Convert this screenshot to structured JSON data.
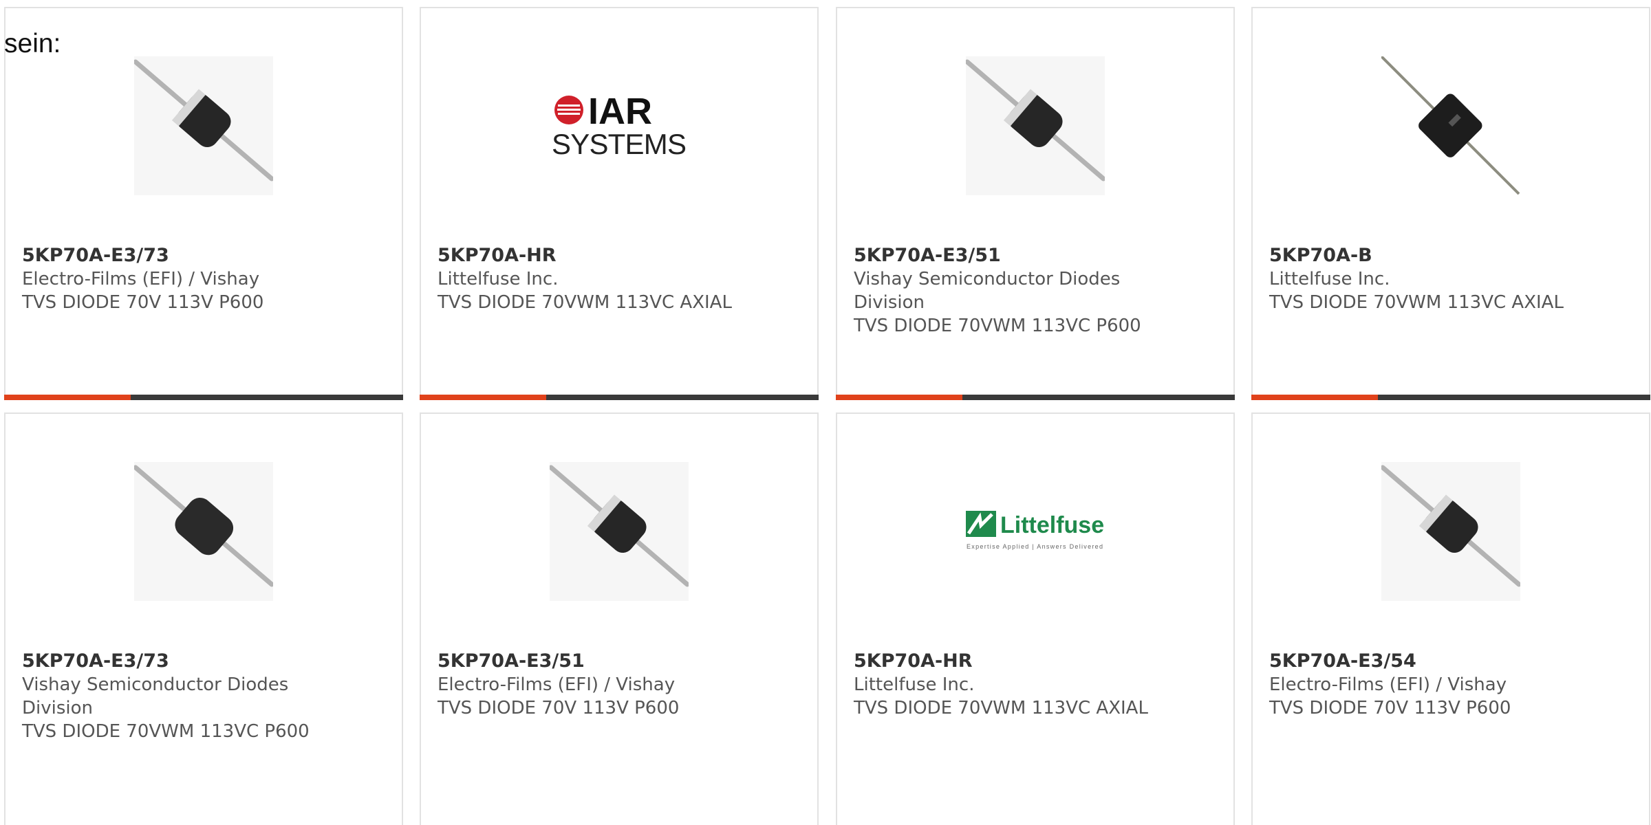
{
  "intro_text": "sein:",
  "products": [
    {
      "part": "5KP70A-E3/73",
      "maker": "Electro-Films (EFI) / Vishay",
      "desc": "TVS DIODE 70V 113V P600",
      "image": "diode-axial-white-band-icon"
    },
    {
      "part": "5KP70A-HR",
      "maker": "Littelfuse Inc.",
      "desc": "TVS DIODE 70VWM 113VC AXIAL",
      "image": "iar-systems-logo",
      "logo_text": {
        "top": "IAR",
        "bottom": "SYSTEMS"
      }
    },
    {
      "part": "5KP70A-E3/51",
      "maker": "Vishay Semiconductor Diodes\nDivision",
      "maker_line1": "Vishay Semiconductor Diodes",
      "maker_line2": "Division",
      "desc": "TVS DIODE 70VWM 113VC P600",
      "image": "diode-axial-white-band-icon"
    },
    {
      "part": "5KP70A-B",
      "maker": "Littelfuse Inc.",
      "desc": "TVS DIODE 70VWM 113VC AXIAL",
      "image": "diode-axial-square-icon"
    },
    {
      "part": "5KP70A-E3/73",
      "maker": "Vishay Semiconductor Diodes\nDivision",
      "maker_line1": "Vishay Semiconductor Diodes",
      "maker_line2": "Division",
      "desc": "TVS DIODE 70VWM 113VC P600",
      "image": "diode-axial-plain-icon"
    },
    {
      "part": "5KP70A-E3/51",
      "maker": "Electro-Films (EFI) / Vishay",
      "desc": "TVS DIODE 70V 113V P600",
      "image": "diode-axial-white-band-icon"
    },
    {
      "part": "5KP70A-HR",
      "maker": "Littelfuse Inc.",
      "desc": "TVS DIODE 70VWM 113VC AXIAL",
      "image": "littelfuse-logo",
      "logo_text": {
        "name": "Littelfuse",
        "tagline": "Expertise Applied | Answers Delivered"
      }
    },
    {
      "part": "5KP70A-E3/54",
      "maker": "Electro-Films (EFI) / Vishay",
      "desc": "TVS DIODE 70V 113V P600",
      "image": "diode-axial-white-band-icon"
    }
  ],
  "colors": {
    "accent": "#e0421b",
    "bar": "#3a3a3a",
    "border": "#e2e2e2",
    "text": "#555555",
    "part_number": "#333333",
    "littelfuse_green": "#1f8a4c",
    "iar_red": "#d0202a"
  }
}
